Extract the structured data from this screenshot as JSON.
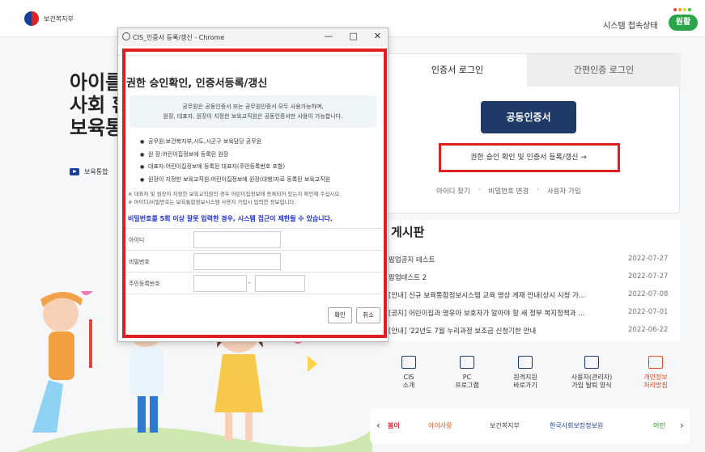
{
  "header": {
    "logo_text": "보건복지부",
    "system_status_label": "시스템 접속상태",
    "status_badge": "원활"
  },
  "hero": {
    "line1": "아이를",
    "line2": "사회 환",
    "line3": "보육통",
    "video_link": "보육통합"
  },
  "login": {
    "tab_cert": "인증서 로그인",
    "tab_simple": "간편인증 로그인",
    "cert_button": "공동인증서",
    "renew_button": "권한 승인 확인 및 인증서 등록/갱신  →",
    "links": [
      "아이디 찾기",
      "·",
      "비밀번호 변경",
      "·",
      "사용자 가입"
    ]
  },
  "board": {
    "title": "게시판",
    "rows": [
      {
        "title": "팝업공지 테스트",
        "date": "2022-07-27"
      },
      {
        "title": "팝업테스트 2",
        "date": "2022-07-27"
      },
      {
        "title": "[안내] 신규 보육통합정보시스템 교육 영상 게재 안내(상시 시청 가...",
        "date": "2022-07-08"
      },
      {
        "title": "[공지] 어린이집과 영유아 보호자가 알아야 할 새 정부 복지정책과 ...",
        "date": "2022-07-01"
      },
      {
        "title": "[안내] '22년도 7월 누리과정 보조금 신청기한 안내",
        "date": "2022-06-22"
      }
    ]
  },
  "quick_links": [
    {
      "line1": "CIS",
      "line2": "소개"
    },
    {
      "line1": "PC",
      "line2": "프로그램"
    },
    {
      "line1": "원격지원",
      "line2": "바로가기"
    },
    {
      "line1": "사용자(관리자)",
      "line2": "가입 탈퇴 양식"
    },
    {
      "line1": "개인정보",
      "line2": "처리방침"
    }
  ],
  "partners": [
    "봄이",
    "아이사랑",
    "보건복지부",
    "한국사회보장정보원",
    "어린"
  ],
  "popup": {
    "window_title": "CIS_인증서 등록/갱신 - Chrome",
    "title": "권한 승인확인, 인증서등록/갱신",
    "info_line1": "공무원은 공동인증서 또는 공무원인증서 모두 사용가능하며,",
    "info_line2": "원장, 대표자, 원장이 지정한 보육교직원은 공동인증서만 사용이 가능합니다.",
    "bullets": [
      "공무원:보건복지부,시도,시군구 보육담당 공무원",
      "원  장:어린이집정보에 등록된 원장",
      "대표자:어린이집정보에 등록된 대표자(주민등록번호 포함)",
      "원장이 지정한 보육교직원:어린이집정보에 원장(대행)자로 등록된 보육교직원"
    ],
    "note1": "※ 대표자 및 원장이 지정한 보육교직원의 경우 어린이집정보에 등록되어 있는지 확인해 주십시오.",
    "note2": "※ 아이디/비밀번호는 보육통합정보시스템 사용자 가입시 입력한 정보입니다.",
    "warning": "비밀번호를 5회 이상 잘못 입력한 경우, 시스템 접근이 제한될 수 있습니다.",
    "label_id": "아이디",
    "label_pw": "비밀번호",
    "label_rrn": "주민등록번호",
    "confirm": "확인",
    "cancel": "취소"
  }
}
